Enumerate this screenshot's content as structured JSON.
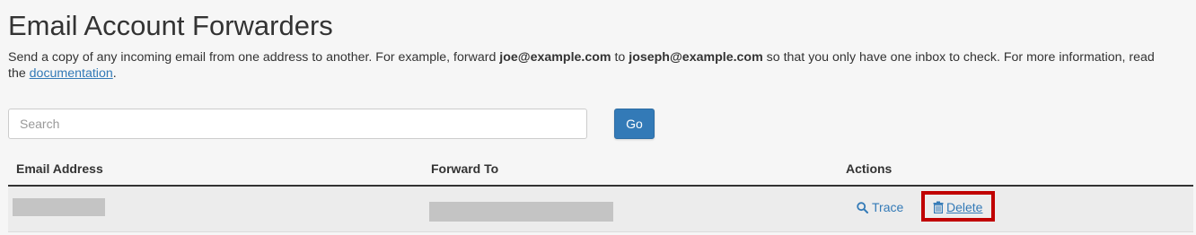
{
  "page": {
    "title": "Email Account Forwarders",
    "description": {
      "part1": "Send a copy of any incoming email from one address to another. For example, forward ",
      "example_from": "joe@example.com",
      "part2": " to ",
      "example_to": "joseph@example.com",
      "part3": " so that you only have one inbox to check. For more information, read the ",
      "doc_link": "documentation",
      "part4": "."
    }
  },
  "search": {
    "placeholder": "Search",
    "value": "",
    "go_label": "Go"
  },
  "table": {
    "headers": {
      "email_address": "Email Address",
      "forward_to": "Forward To",
      "actions": "Actions"
    },
    "rows": [
      {
        "trace_label": "Trace",
        "delete_label": "Delete"
      }
    ]
  },
  "colors": {
    "accent": "#337ab7",
    "highlight": "#c00000"
  },
  "icons": {
    "trace": "search-icon",
    "delete": "trash-icon"
  }
}
